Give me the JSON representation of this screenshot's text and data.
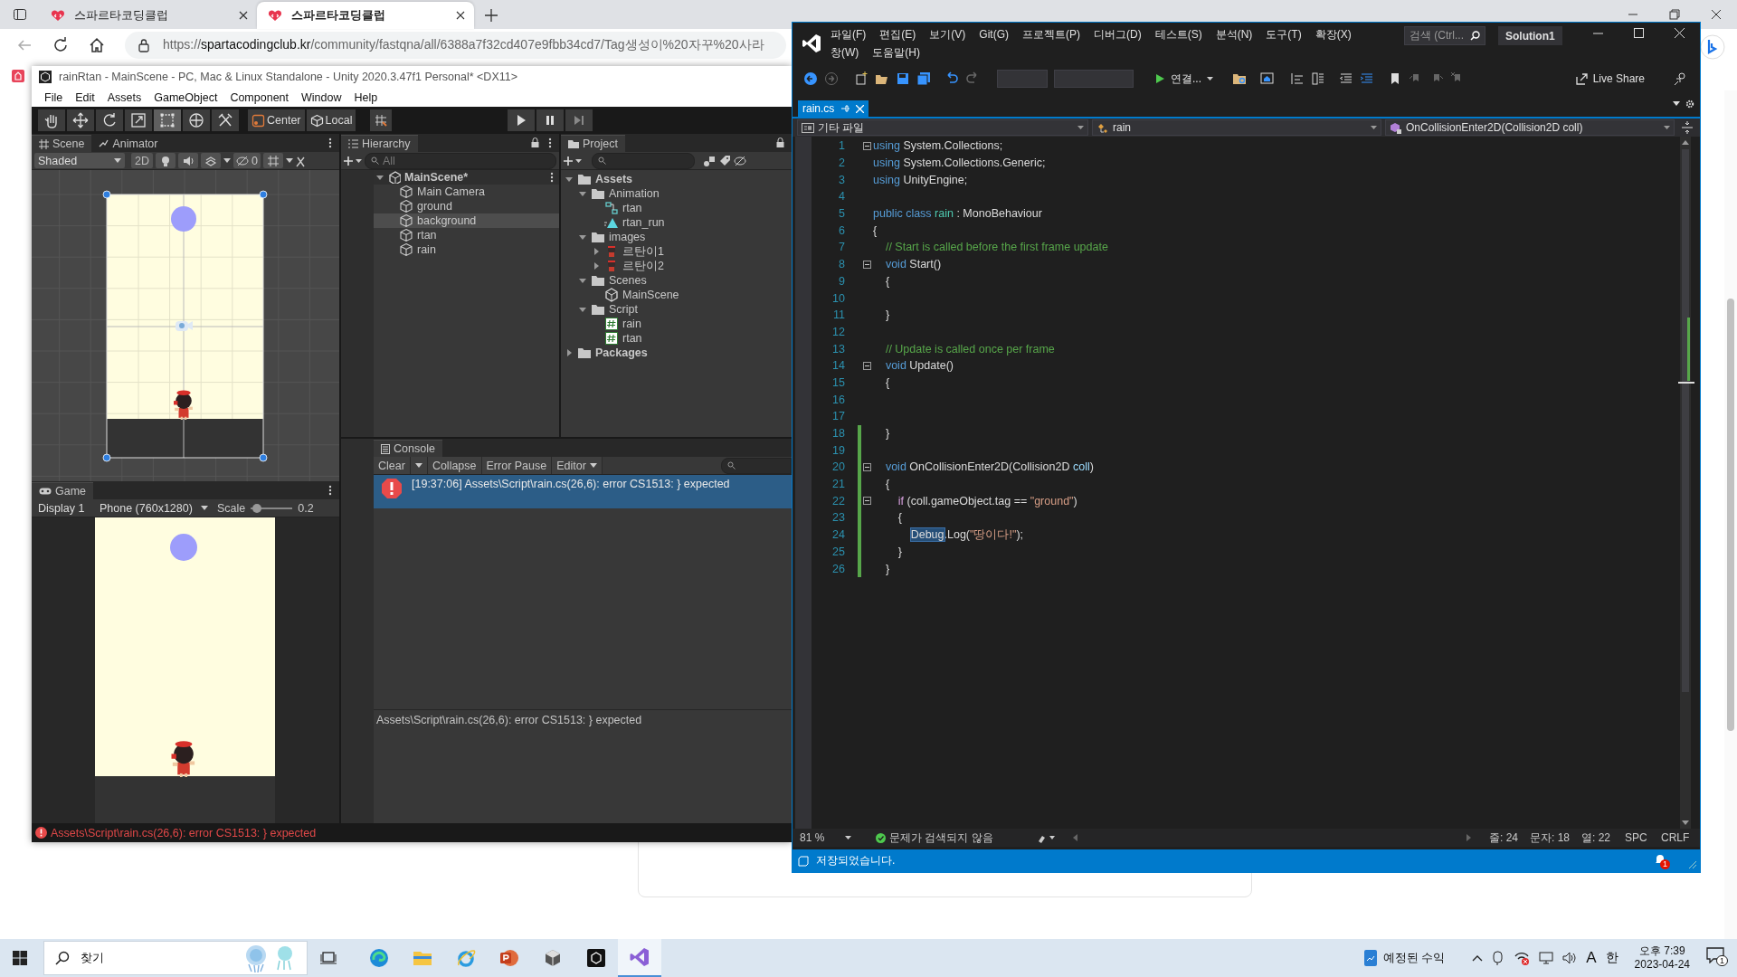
{
  "browser": {
    "tabs": [
      {
        "title": "스파르타코딩클럽",
        "selected": false
      },
      {
        "title": "스파르타코딩클럽",
        "selected": true
      }
    ],
    "url_scheme": "https://",
    "url_host": "spartacodingclub.kr",
    "url_path": "/community/fastqna/all/6388a7f32cd407e9fbb34cd7/Tag생성이%20자꾸%20사라"
  },
  "unity": {
    "title": "rainRtan - MainScene - PC, Mac & Linux Standalone - Unity 2020.3.47f1 Personal* <DX11>",
    "menu": [
      "File",
      "Edit",
      "Assets",
      "GameObject",
      "Component",
      "Window",
      "Help"
    ],
    "tools": [
      {
        "kind": "hand",
        "selected": false
      },
      {
        "kind": "move",
        "selected": false
      },
      {
        "kind": "rotate",
        "selected": false
      },
      {
        "kind": "scale",
        "selected": false
      },
      {
        "kind": "rect",
        "selected": true
      },
      {
        "kind": "transform",
        "selected": false
      },
      {
        "kind": "custom",
        "selected": false
      }
    ],
    "pivot_buttons": [
      {
        "kind": "pivot",
        "label": "Center"
      },
      {
        "kind": "space",
        "label": "Local"
      }
    ],
    "scene": {
      "tabs": [
        {
          "label": "Scene",
          "selected": true
        },
        {
          "label": "Animator",
          "selected": false
        }
      ],
      "shading": "Shaded",
      "mode_2d": "2D",
      "hidden_count": "0"
    },
    "game": {
      "tab": "Game",
      "display": "Display 1",
      "resolution": "Phone (760x1280)",
      "scale": {
        "label": "Scale",
        "reading": "0.2",
        "level": 0.05
      }
    },
    "hierarchy": {
      "title": "Hierarchy",
      "search": {
        "placeholder": "All"
      },
      "scene": {
        "name": "MainScene*",
        "expanded": true
      },
      "objects": [
        {
          "name": "Main Camera",
          "selected": false
        },
        {
          "name": "ground",
          "selected": false
        },
        {
          "name": "background",
          "selected": true
        },
        {
          "name": "rtan",
          "selected": false
        },
        {
          "name": "rain",
          "selected": false
        }
      ]
    },
    "project": {
      "title": "Project",
      "tree": [
        {
          "name": "Assets",
          "kind": "folder",
          "expanded": true,
          "children": [
            {
              "name": "Animation",
              "kind": "folder",
              "expanded": true,
              "children": [
                {
                  "name": "rtan",
                  "kind": "animator"
                },
                {
                  "name": "rtan_run",
                  "kind": "clip"
                }
              ]
            },
            {
              "name": "images",
              "kind": "folder",
              "expanded": true,
              "children": [
                {
                  "name": "르탄이1",
                  "kind": "sprite",
                  "expanded": false
                },
                {
                  "name": "르탄이2",
                  "kind": "sprite",
                  "expanded": false
                }
              ]
            },
            {
              "name": "Scenes",
              "kind": "folder",
              "expanded": true,
              "children": [
                {
                  "name": "MainScene",
                  "kind": "scene"
                }
              ]
            },
            {
              "name": "Script",
              "kind": "folder",
              "expanded": true,
              "children": [
                {
                  "name": "rain",
                  "kind": "script"
                },
                {
                  "name": "rtan",
                  "kind": "script"
                }
              ]
            }
          ]
        },
        {
          "name": "Packages",
          "kind": "folder",
          "expanded": false
        }
      ]
    },
    "console": {
      "title": "Console",
      "buttons": [
        {
          "label": "Clear",
          "kind": "split"
        },
        {
          "label": "Collapse",
          "kind": "toggle"
        },
        {
          "label": "Error Pause",
          "kind": "toggle"
        },
        {
          "label": "Editor",
          "kind": "dropdown"
        }
      ],
      "entries": [
        {
          "text": "[19:37:06] Assets\\Script\\rain.cs(26,6): error CS1513: } expected",
          "kind": "error",
          "selected": true
        }
      ],
      "detail": "Assets\\Script\\rain.cs(26,6): error CS1513: } expected"
    },
    "status": {
      "kind": "error",
      "text": "Assets\\Script\\rain.cs(26,6): error CS1513: } expected"
    }
  },
  "vs": {
    "menu_rows": [
      [
        "파일(F)",
        "편집(E)",
        "보기(V)",
        "Git(G)",
        "프로젝트(P)",
        "디버그(D)",
        "테스트(S)",
        "분석(N)",
        "도구(T)",
        "확장(X)"
      ],
      [
        "창(W)",
        "도움말(H)"
      ]
    ],
    "search": {
      "placeholder": "검색 (Ctrl..."
    },
    "solution": "Solution1",
    "run_label": "연결...",
    "live_share": "Live Share",
    "tabs": [
      {
        "label": "rain.cs",
        "selected": true
      }
    ],
    "nav": [
      {
        "kind": "project",
        "label": "기타 파일"
      },
      {
        "kind": "class",
        "label": "rain"
      },
      {
        "kind": "member",
        "label": "OnCollisionEnter2D(Collision2D coll)"
      }
    ],
    "lines": [
      {
        "number": "1",
        "fold": true,
        "modified": false,
        "tokens": [
          {
            "kind": "kw",
            "text": "using"
          },
          {
            "kind": "plain",
            "text": " System.Collections;"
          }
        ]
      },
      {
        "number": "2",
        "fold": false,
        "modified": false,
        "tokens": [
          {
            "kind": "kw",
            "text": "using"
          },
          {
            "kind": "plain",
            "text": " System.Collections.Generic;"
          }
        ]
      },
      {
        "number": "3",
        "fold": false,
        "modified": false,
        "tokens": [
          {
            "kind": "kw",
            "text": "using"
          },
          {
            "kind": "plain",
            "text": " UnityEngine;"
          }
        ]
      },
      {
        "number": "4",
        "fold": false,
        "modified": false
      },
      {
        "number": "5",
        "fold": false,
        "modified": false,
        "tokens": [
          {
            "kind": "kw",
            "text": "public class "
          },
          {
            "kind": "type",
            "text": "rain"
          },
          {
            "kind": "plain",
            "text": " : MonoBehaviour"
          }
        ]
      },
      {
        "number": "6",
        "fold": false,
        "modified": false,
        "tokens": [
          {
            "kind": "plain",
            "text": "{"
          }
        ]
      },
      {
        "number": "7",
        "fold": false,
        "modified": false,
        "tokens": [
          {
            "kind": "comment",
            "text": "    // Start is called before the first frame update"
          }
        ]
      },
      {
        "number": "8",
        "fold": true,
        "modified": false,
        "tokens": [
          {
            "kind": "kw",
            "text": "    void"
          },
          {
            "kind": "plain",
            "text": " Start()"
          }
        ]
      },
      {
        "number": "9",
        "fold": false,
        "modified": false,
        "tokens": [
          {
            "kind": "plain",
            "text": "    {"
          }
        ]
      },
      {
        "number": "10",
        "fold": false,
        "modified": false
      },
      {
        "number": "11",
        "fold": false,
        "modified": false,
        "tokens": [
          {
            "kind": "plain",
            "text": "    }"
          }
        ]
      },
      {
        "number": "12",
        "fold": false,
        "modified": false
      },
      {
        "number": "13",
        "fold": false,
        "modified": false,
        "tokens": [
          {
            "kind": "comment",
            "text": "    // Update is called once per frame"
          }
        ]
      },
      {
        "number": "14",
        "fold": true,
        "modified": false,
        "tokens": [
          {
            "kind": "kw",
            "text": "    void"
          },
          {
            "kind": "plain",
            "text": " Update()"
          }
        ]
      },
      {
        "number": "15",
        "fold": false,
        "modified": false,
        "tokens": [
          {
            "kind": "plain",
            "text": "    {"
          }
        ]
      },
      {
        "number": "16",
        "fold": false,
        "modified": false
      },
      {
        "number": "17",
        "fold": false,
        "modified": false
      },
      {
        "number": "18",
        "fold": false,
        "modified": true,
        "tokens": [
          {
            "kind": "plain",
            "text": "    }"
          }
        ]
      },
      {
        "number": "19",
        "fold": false,
        "modified": true
      },
      {
        "number": "20",
        "fold": true,
        "modified": true,
        "tokens": [
          {
            "kind": "kw",
            "text": "    void"
          },
          {
            "kind": "plain",
            "text": " OnCollisionEnter2D(Collision2D "
          },
          {
            "kind": "param",
            "text": "coll"
          },
          {
            "kind": "plain",
            "text": ")"
          }
        ]
      },
      {
        "number": "21",
        "fold": false,
        "modified": true,
        "tokens": [
          {
            "kind": "plain",
            "text": "    {"
          }
        ]
      },
      {
        "number": "22",
        "fold": true,
        "modified": true,
        "tokens": [
          {
            "kind": "ctl",
            "text": "        if"
          },
          {
            "kind": "plain",
            "text": " (coll.gameObject.tag == "
          },
          {
            "kind": "str",
            "text": "\"ground\""
          },
          {
            "kind": "plain",
            "text": ")"
          }
        ]
      },
      {
        "number": "23",
        "fold": false,
        "modified": true,
        "tokens": [
          {
            "kind": "plain",
            "text": "        {"
          }
        ]
      },
      {
        "number": "24",
        "fold": false,
        "modified": true,
        "tokens": [
          {
            "kind": "sel",
            "text": "            Debug"
          },
          {
            "kind": "plain",
            "text": ".Log("
          },
          {
            "kind": "str",
            "text": "\"땅이다!\""
          },
          {
            "kind": "plain",
            "text": ");"
          }
        ]
      },
      {
        "number": "25",
        "fold": false,
        "modified": true,
        "tokens": [
          {
            "kind": "plain",
            "text": "        }"
          }
        ]
      },
      {
        "number": "26",
        "fold": false,
        "modified": true,
        "tokens": [
          {
            "kind": "plain",
            "text": "    }"
          }
        ]
      }
    ],
    "status": {
      "zoom": "81 %",
      "issues": "문제가 검색되지 않음",
      "line": "줄: 24",
      "char": "문자: 18",
      "col": "열: 22",
      "whitespace": "SPC",
      "eol": "CRLF"
    },
    "message": "저장되었습니다.",
    "notifications": "1"
  },
  "taskbar": {
    "search": {
      "placeholder": "찾기"
    },
    "apps": [
      {
        "kind": "edge",
        "selected": false
      },
      {
        "kind": "explorer",
        "selected": false
      },
      {
        "kind": "ie",
        "selected": false
      },
      {
        "kind": "powerpoint",
        "selected": false
      },
      {
        "kind": "hub",
        "selected": false
      },
      {
        "kind": "unity",
        "selected": false
      },
      {
        "kind": "vs",
        "selected": true
      }
    ],
    "widget": "예정된 수익",
    "ime_mode": "A",
    "ime_lang": "한",
    "time": "오후 7:39",
    "date": "2023-04-24",
    "notifications": "1"
  }
}
